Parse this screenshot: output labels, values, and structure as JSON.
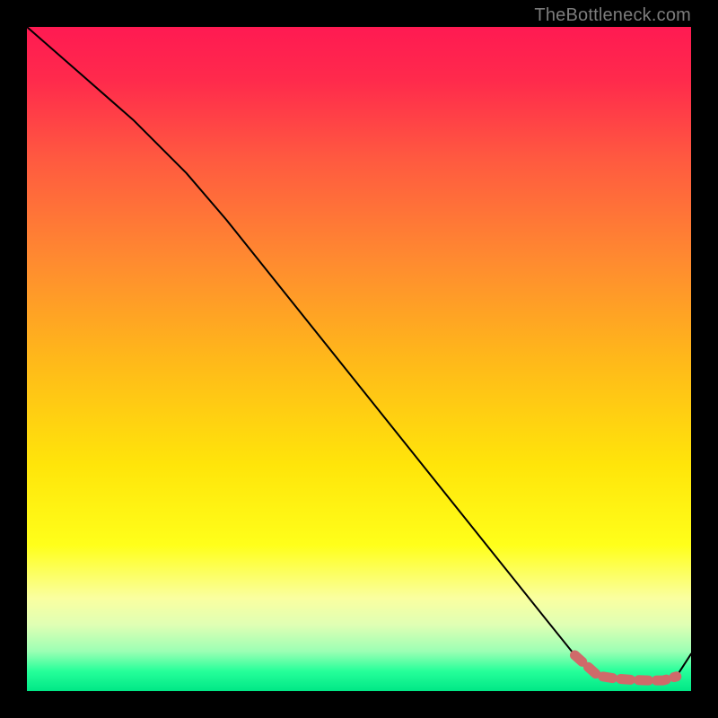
{
  "watermark": "TheBottleneck.com",
  "colors": {
    "frame": "#000000",
    "curve": "#000000",
    "marker": "#cf6a6a",
    "stops": [
      {
        "pos": 0.0,
        "hex": "#ff1a52"
      },
      {
        "pos": 0.08,
        "hex": "#ff2a4c"
      },
      {
        "pos": 0.2,
        "hex": "#ff5a40"
      },
      {
        "pos": 0.35,
        "hex": "#ff8a30"
      },
      {
        "pos": 0.5,
        "hex": "#ffb81a"
      },
      {
        "pos": 0.66,
        "hex": "#ffe50a"
      },
      {
        "pos": 0.78,
        "hex": "#ffff1a"
      },
      {
        "pos": 0.86,
        "hex": "#faffa0"
      },
      {
        "pos": 0.9,
        "hex": "#e0ffb4"
      },
      {
        "pos": 0.94,
        "hex": "#9cffb4"
      },
      {
        "pos": 0.97,
        "hex": "#26ff9a"
      },
      {
        "pos": 1.0,
        "hex": "#00e786"
      }
    ]
  },
  "chart_data": {
    "type": "line",
    "title": "",
    "xlabel": "",
    "ylabel": "",
    "xlim": [
      0,
      100
    ],
    "ylim": [
      0,
      100
    ],
    "grid": false,
    "legend": false,
    "series": [
      {
        "name": "bottleneck-curve",
        "x": [
          0,
          8,
          16,
          24,
          30,
          36,
          42,
          48,
          54,
          60,
          66,
          72,
          78,
          82.5,
          86,
          88.5,
          91,
          93.5,
          95.8,
          97.8,
          100
        ],
        "y": [
          100,
          93,
          86,
          78,
          71,
          63.5,
          56,
          48.5,
          41,
          33.5,
          26,
          18.5,
          11,
          5.4,
          2.3,
          1.9,
          1.7,
          1.6,
          1.6,
          2.2,
          5.6
        ]
      }
    ],
    "markers": [
      {
        "name": "highlight-segment",
        "type": "stroke",
        "x": [
          82.5,
          86,
          88.5,
          91,
          93.5,
          95.8,
          97.8
        ],
        "y": [
          5.4,
          2.3,
          1.9,
          1.7,
          1.6,
          1.6,
          2.2
        ]
      }
    ]
  }
}
